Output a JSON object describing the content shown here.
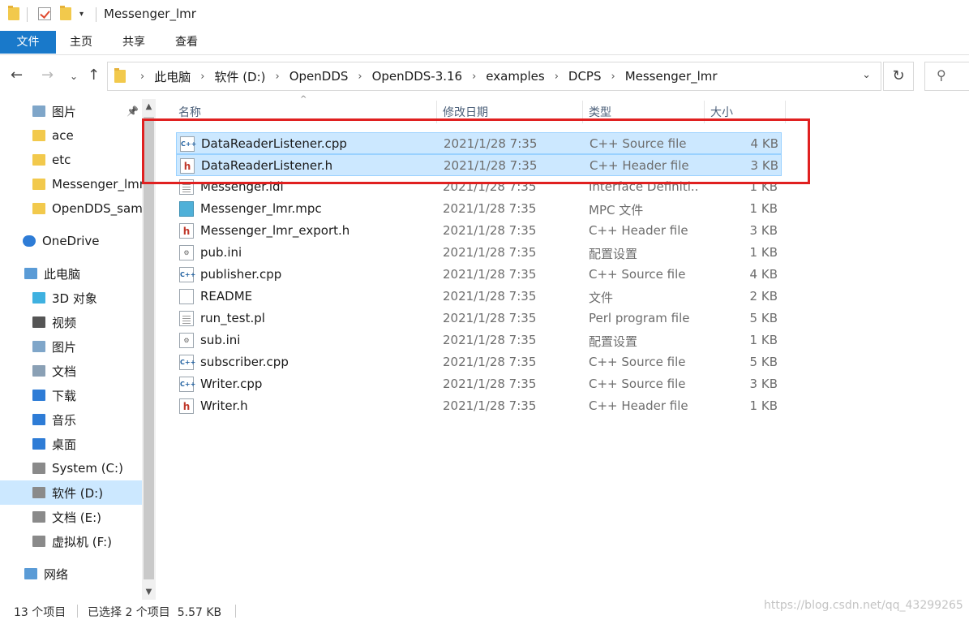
{
  "window": {
    "title": "Messenger_lmr"
  },
  "ribbon": {
    "tabs": [
      "文件",
      "主页",
      "共享",
      "查看"
    ]
  },
  "address": {
    "crumbs": [
      "此电脑",
      "软件 (D:)",
      "OpenDDS",
      "OpenDDS-3.16",
      "examples",
      "DCPS",
      "Messenger_lmr"
    ]
  },
  "nav_pane": {
    "items": [
      {
        "label": "图片",
        "icon": "pictures-icon",
        "pinned": true
      },
      {
        "label": "ace",
        "icon": "folder-icon"
      },
      {
        "label": "etc",
        "icon": "folder-icon"
      },
      {
        "label": "Messenger_lmr",
        "icon": "folder-icon"
      },
      {
        "label": "OpenDDS_samp",
        "icon": "folder-icon"
      },
      {
        "label": "OneDrive",
        "icon": "cloud-icon"
      },
      {
        "label": "此电脑",
        "icon": "computer-icon"
      },
      {
        "label": "3D 对象",
        "icon": "3d-objects-icon"
      },
      {
        "label": "视频",
        "icon": "video-icon"
      },
      {
        "label": "图片",
        "icon": "pictures-icon"
      },
      {
        "label": "文档",
        "icon": "documents-icon"
      },
      {
        "label": "下载",
        "icon": "download-icon"
      },
      {
        "label": "音乐",
        "icon": "music-icon"
      },
      {
        "label": "桌面",
        "icon": "desktop-icon"
      },
      {
        "label": "System (C:)",
        "icon": "drive-icon"
      },
      {
        "label": "软件 (D:)",
        "icon": "drive-icon",
        "selected": true
      },
      {
        "label": "文档 (E:)",
        "icon": "drive-icon"
      },
      {
        "label": "虚拟机 (F:)",
        "icon": "drive-icon"
      },
      {
        "label": "网络",
        "icon": "network-icon"
      }
    ]
  },
  "columns": {
    "name": "名称",
    "date": "修改日期",
    "type": "类型",
    "size": "大小"
  },
  "files": [
    {
      "name": "DataReaderListener.cpp",
      "date": "2021/1/28 7:35",
      "type": "C++ Source file",
      "size": "4 KB",
      "icon": "cpp-file-icon",
      "selected": true
    },
    {
      "name": "DataReaderListener.h",
      "date": "2021/1/28 7:35",
      "type": "C++ Header file",
      "size": "3 KB",
      "icon": "header-file-icon",
      "selected": true
    },
    {
      "name": "Messenger.idl",
      "date": "2021/1/28 7:35",
      "type": "Interface Definiti...",
      "size": "1 KB",
      "icon": "text-file-icon"
    },
    {
      "name": "Messenger_lmr.mpc",
      "date": "2021/1/28 7:35",
      "type": "MPC 文件",
      "size": "1 KB",
      "icon": "mpc-file-icon"
    },
    {
      "name": "Messenger_lmr_export.h",
      "date": "2021/1/28 7:35",
      "type": "C++ Header file",
      "size": "3 KB",
      "icon": "header-file-icon"
    },
    {
      "name": "pub.ini",
      "date": "2021/1/28 7:35",
      "type": "配置设置",
      "size": "1 KB",
      "icon": "ini-file-icon"
    },
    {
      "name": "publisher.cpp",
      "date": "2021/1/28 7:35",
      "type": "C++ Source file",
      "size": "4 KB",
      "icon": "cpp-file-icon"
    },
    {
      "name": "README",
      "date": "2021/1/28 7:35",
      "type": "文件",
      "size": "2 KB",
      "icon": "blank-file-icon"
    },
    {
      "name": "run_test.pl",
      "date": "2021/1/28 7:35",
      "type": "Perl program file",
      "size": "5 KB",
      "icon": "text-file-icon"
    },
    {
      "name": "sub.ini",
      "date": "2021/1/28 7:35",
      "type": "配置设置",
      "size": "1 KB",
      "icon": "ini-file-icon"
    },
    {
      "name": "subscriber.cpp",
      "date": "2021/1/28 7:35",
      "type": "C++ Source file",
      "size": "5 KB",
      "icon": "cpp-file-icon"
    },
    {
      "name": "Writer.cpp",
      "date": "2021/1/28 7:35",
      "type": "C++ Source file",
      "size": "3 KB",
      "icon": "cpp-file-icon"
    },
    {
      "name": "Writer.h",
      "date": "2021/1/28 7:35",
      "type": "C++ Header file",
      "size": "1 KB",
      "icon": "header-file-icon"
    }
  ],
  "status": {
    "count": "13 个项目",
    "selection": "已选择 2 个项目  5.57 KB"
  },
  "watermark": "https://blog.csdn.net/qq_43299265",
  "colors": {
    "accent": "#1979ca",
    "selection": "#cce8ff",
    "highlight_box": "#e02020"
  }
}
